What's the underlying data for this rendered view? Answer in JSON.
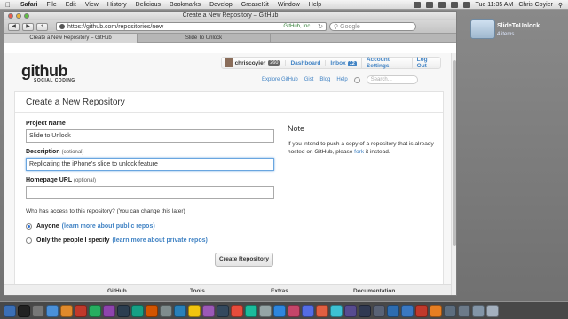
{
  "menubar": {
    "apple": "",
    "items": [
      "Safari",
      "File",
      "Edit",
      "View",
      "History",
      "Delicious",
      "Bookmarks",
      "Develop",
      "GreaseKit",
      "Window",
      "Help"
    ],
    "clock": "Tue 11:35 AM",
    "user": "Chris Coyier"
  },
  "window": {
    "title": "Create a New Repository – GitHub",
    "url": "https://github.com/repositories/new",
    "site_badge": "GitHub, Inc.",
    "search_placeholder": "Google",
    "tabs": [
      "Create a New Repository – GitHub",
      "Slide To Unlock"
    ]
  },
  "header": {
    "logo_main": "github",
    "logo_sub": "SOCIAL CODING",
    "username": "chriscoyier",
    "user_count": "260",
    "dashboard": "Dashboard",
    "inbox": "Inbox",
    "inbox_count": "12",
    "account_settings": "Account Settings",
    "logout": "Log Out",
    "subnav": [
      "Explore GitHub",
      "Gist",
      "Blog",
      "Help"
    ],
    "search_placeholder": "Search..."
  },
  "form": {
    "title": "Create a New Repository",
    "project_name_label": "Project Name",
    "project_name_value": "Slide to Unlock",
    "description_label": "Description",
    "description_optional": "(optional)",
    "description_value": "Replicating the iPhone's slide to unlock feature",
    "homepage_label": "Homepage URL",
    "homepage_optional": "(optional)",
    "homepage_value": "",
    "access_question": "Who has access to this repository? (You can change this later)",
    "option_public": "Anyone",
    "option_public_link": "(learn more about public repos)",
    "option_private": "Only the people I specify",
    "option_private_link": "(learn more about private repos)",
    "create_button": "Create Repository"
  },
  "note": {
    "title": "Note",
    "text_before": "If you intend to push a copy of a repository that is already hosted on GitHub, please",
    "link": "fork",
    "text_after": "it instead."
  },
  "footer": {
    "columns": [
      "GitHub",
      "Tools",
      "Extras",
      "Documentation"
    ]
  },
  "desktop": {
    "folder_label": "SlideToUnlock",
    "folder_sub": "4 items"
  },
  "colors": {
    "link": "#4183c4",
    "focus": "#6aa6e0"
  }
}
